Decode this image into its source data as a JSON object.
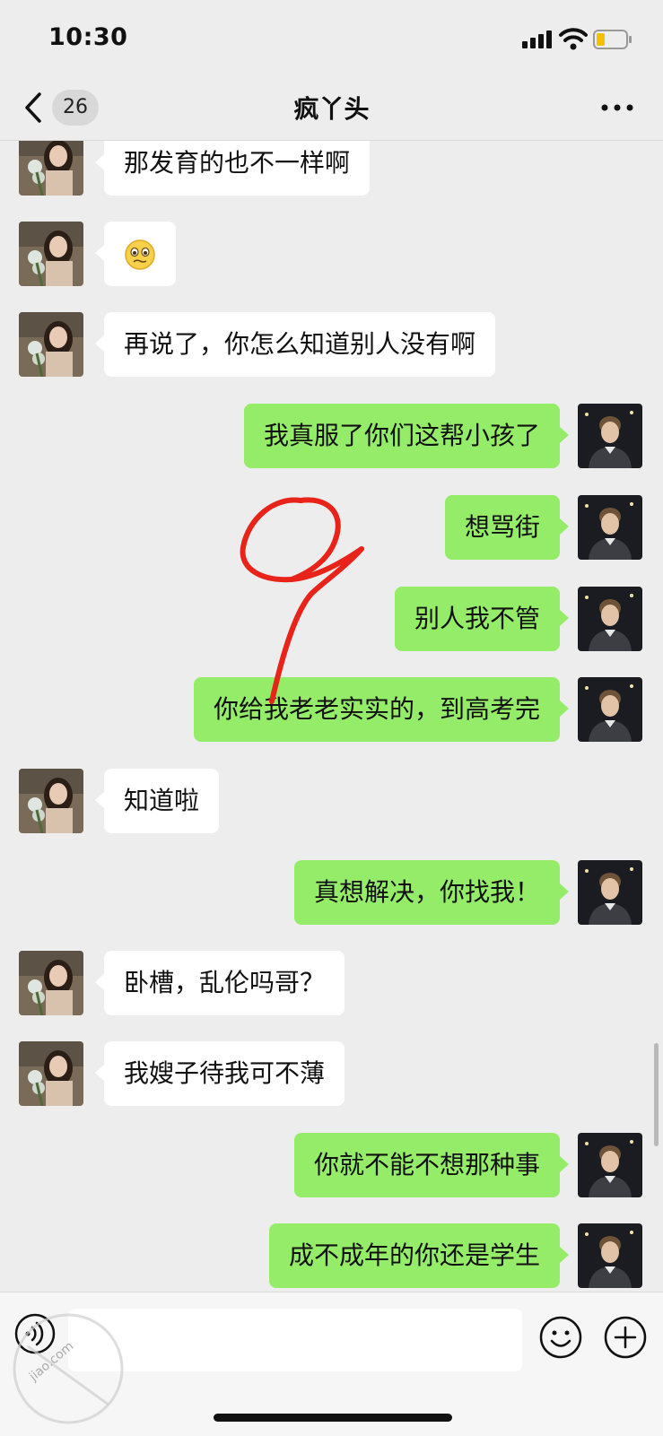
{
  "status_bar": {
    "time": "10:30"
  },
  "nav": {
    "unread_count": "26",
    "title": "疯丫头"
  },
  "messages": [
    {
      "side": "in",
      "text": "那发育的也不一样啊"
    },
    {
      "side": "in",
      "text": "",
      "emoji": "pleading-face"
    },
    {
      "side": "in",
      "text": "再说了，你怎么知道别人没有啊"
    },
    {
      "side": "out",
      "text": "我真服了你们这帮小孩了"
    },
    {
      "side": "out",
      "text": "想骂街"
    },
    {
      "side": "out",
      "text": "别人我不管"
    },
    {
      "side": "out",
      "text": "你给我老老实实的，到高考完"
    },
    {
      "side": "in",
      "text": "知道啦"
    },
    {
      "side": "out",
      "text": "真想解决，你找我！"
    },
    {
      "side": "in",
      "text": "卧槽，乱伦吗哥？"
    },
    {
      "side": "in",
      "text": "我嫂子待我可不薄"
    },
    {
      "side": "out",
      "text": "你就不能不想那种事"
    },
    {
      "side": "out",
      "text": "成不成年的你还是学生"
    }
  ],
  "watermark": {
    "text": "jiao.com"
  },
  "colors": {
    "incoming_bubble": "#ffffff",
    "outgoing_bubble": "#95ec69",
    "background": "#ededed",
    "annotation": "#e8231a"
  }
}
